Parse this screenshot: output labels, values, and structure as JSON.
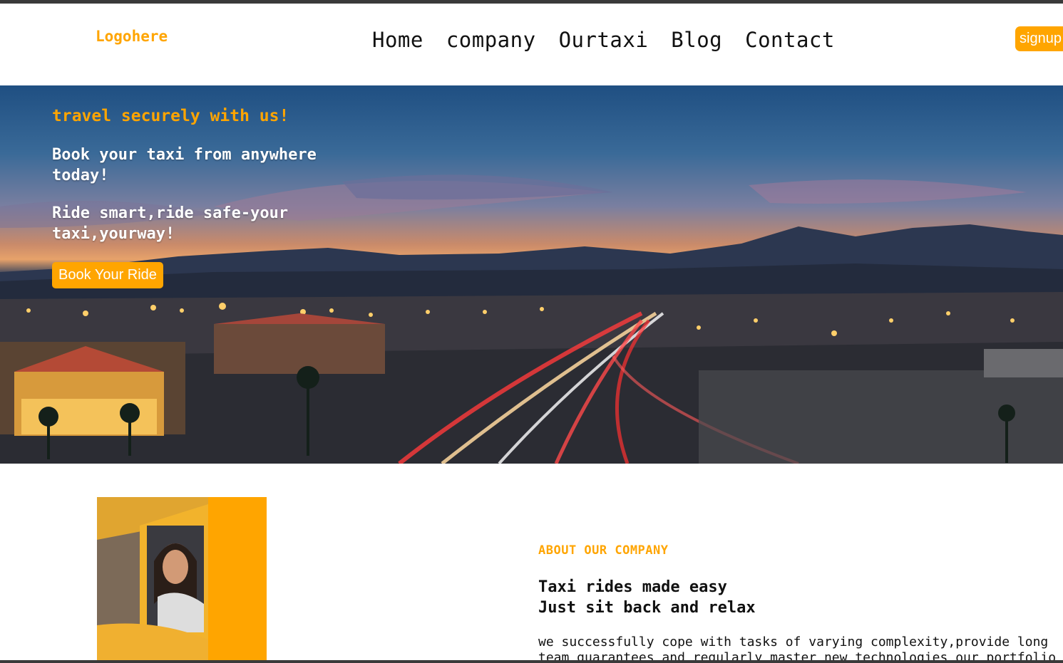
{
  "header": {
    "logo": "Logohere",
    "nav": [
      "Home",
      "company",
      "Ourtaxi",
      "Blog",
      "Contact"
    ],
    "signup_label": "signup"
  },
  "hero": {
    "tagline": "travel securely with us!",
    "line1": "Book your taxi from anywhere today!",
    "line2": "Ride smart,ride safe-your taxi,yourway!",
    "button_label": "Book Your Ride"
  },
  "about": {
    "label": "ABOUT OUR COMPANY",
    "title_line1": "Taxi rides made easy",
    "title_line2": "Just sit back and relax",
    "body_line1": "we successfully cope with tasks of varying complexity,provide long",
    "body_line2": "team guarantees and regularly master new technologies our portfolio"
  },
  "colors": {
    "accent": "#ffa500",
    "text": "#111111",
    "white": "#ffffff"
  }
}
